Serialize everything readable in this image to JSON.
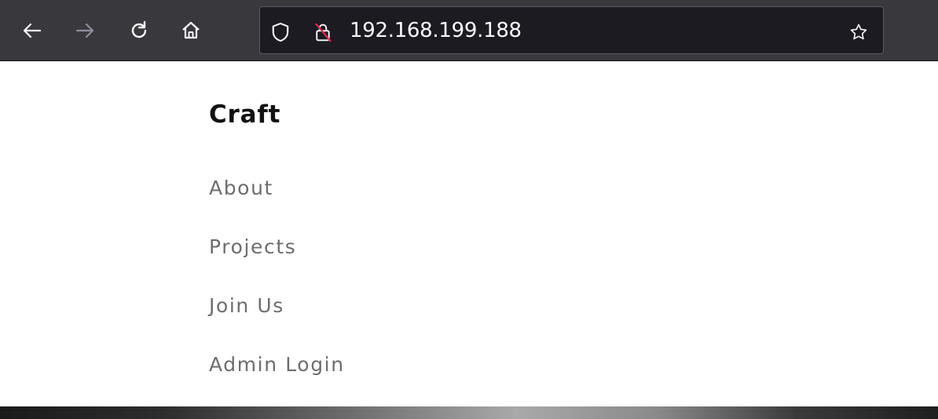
{
  "browser": {
    "back_icon": "back-arrow-icon",
    "forward_icon": "forward-arrow-icon",
    "reload_icon": "reload-icon",
    "home_icon": "home-icon",
    "shield_icon": "tracking-protection-shield-icon",
    "lock_icon": "insecure-connection-lock-icon",
    "bookmark_icon": "bookmark-star-icon",
    "url": "192.168.199.188",
    "colors": {
      "toolbar": "#38383d",
      "urlbar": "#1c1b22",
      "insecure_strike": "#e22850"
    }
  },
  "site": {
    "brand": "Craft",
    "nav": [
      {
        "label": "About"
      },
      {
        "label": "Projects"
      },
      {
        "label": "Join Us"
      },
      {
        "label": "Admin Login"
      }
    ]
  }
}
